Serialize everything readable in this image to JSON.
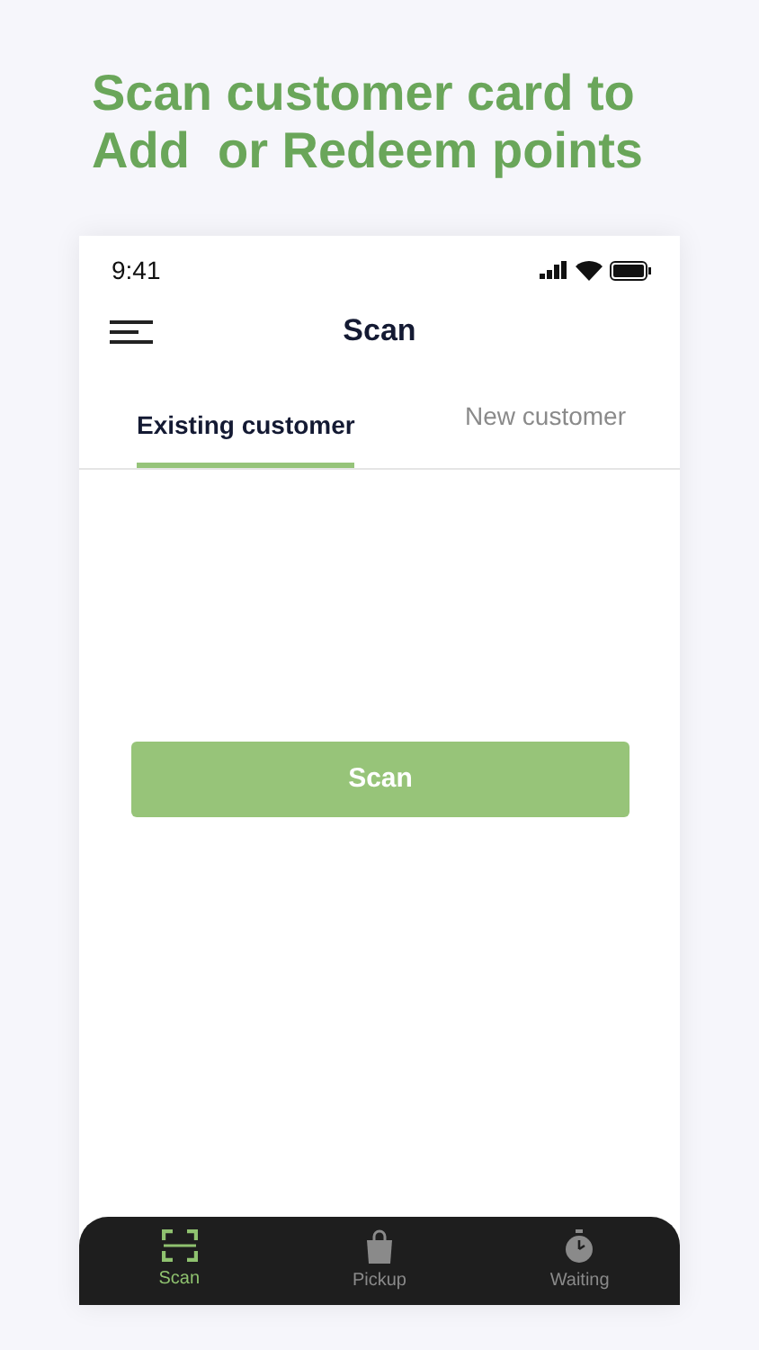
{
  "headline": "Scan customer card to Add  or Redeem points",
  "status_bar": {
    "time": "9:41"
  },
  "header": {
    "title": "Scan"
  },
  "tabs": [
    {
      "label": "Existing customer",
      "selected": true
    },
    {
      "label": "New customer",
      "selected": false
    }
  ],
  "scan_button": "Scan",
  "bottom_nav": [
    {
      "label": "Scan",
      "kind": "scan",
      "selected": true
    },
    {
      "label": "Pickup",
      "kind": "bag",
      "selected": false
    },
    {
      "label": "Waiting",
      "kind": "stopwatch",
      "selected": false
    }
  ]
}
